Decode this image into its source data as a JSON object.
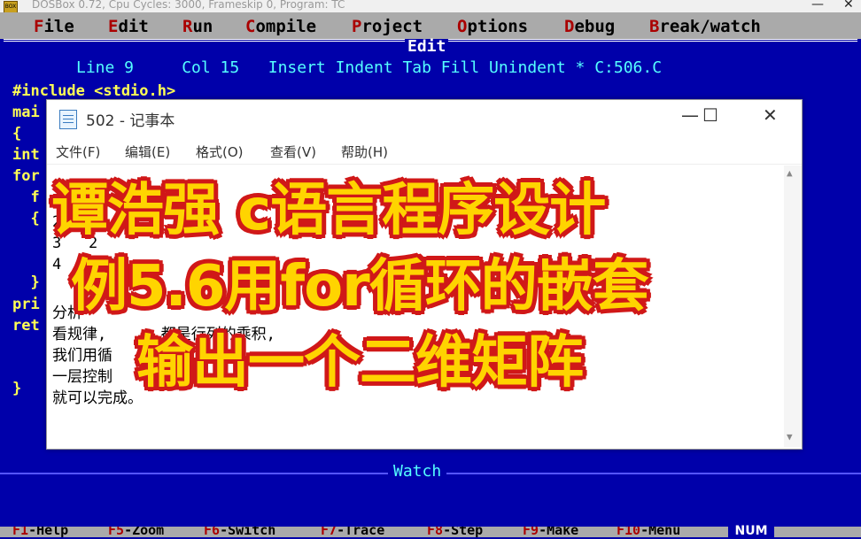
{
  "dosbox": {
    "title": "DOSBox 0.72, Cpu Cycles:     3000, Frameskip  0, Program:     TC",
    "icon": "dosbox-icon",
    "minimize": "—",
    "close": "✕"
  },
  "menubar": {
    "items": [
      {
        "hot": "F",
        "rest": "ile"
      },
      {
        "hot": "E",
        "rest": "dit"
      },
      {
        "hot": "R",
        "rest": "un"
      },
      {
        "hot": "C",
        "rest": "ompile"
      },
      {
        "hot": "P",
        "rest": "roject"
      },
      {
        "hot": "O",
        "rest": "ptions"
      },
      {
        "hot": "D",
        "rest": "ebug"
      },
      {
        "hot": "B",
        "rest": "reak/watch"
      }
    ]
  },
  "editor": {
    "title": "Edit",
    "status": "Line 9     Col 15   Insert Indent Tab Fill Unindent * C:506.C",
    "code": [
      "#include <stdio.h>",
      "mai",
      "{",
      "int",
      "for",
      "  f",
      "  {",
      "",
      "",
      "  }",
      "pri",
      "ret",
      "",
      "",
      "}"
    ]
  },
  "watch": {
    "title": "Watch"
  },
  "fkeys": [
    {
      "k": "F1",
      "label": "-Help"
    },
    {
      "k": "F5",
      "label": "-Zoom"
    },
    {
      "k": "F6",
      "label": "-Switch"
    },
    {
      "k": "F7",
      "label": "-Trace"
    },
    {
      "k": "F8",
      "label": "-Step"
    },
    {
      "k": "F9",
      "label": "-Make"
    },
    {
      "k": "F10",
      "label": "-Menu"
    }
  ],
  "num_indicator": "NUM",
  "notepad": {
    "title": "502 - 记事本",
    "minimize": "—",
    "maximize": "☐",
    "close": "✕",
    "menu": [
      "文件(F)",
      "编辑(E)",
      "格式(O)",
      "查看(V)",
      "帮助(H)"
    ],
    "lines": [
      "",
      "1   4",
      "2   8",
      "3   2",
      "4   6 20",
      "",
      "分析",
      "看规律,      都是行列的乘积,",
      "我们用循    嵌套,",
      "一层控制    列。",
      "就可以完成。"
    ],
    "scroll_up": "▲",
    "scroll_down": "▼"
  },
  "overlay": {
    "line1": "谭浩强 c语言程序设计",
    "line2": "例5.6用for循环的嵌套",
    "line3": "输出一个二维矩阵"
  }
}
